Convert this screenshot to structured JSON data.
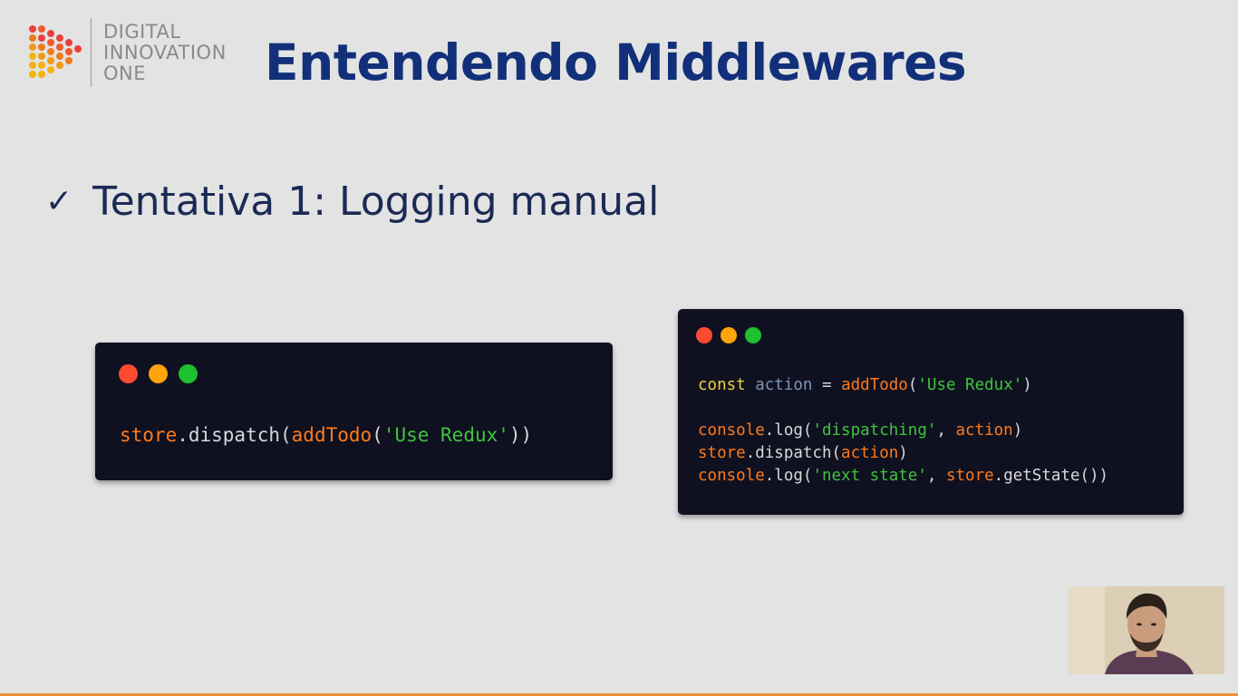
{
  "brand": {
    "line1": "DIGITAL",
    "line2": "INNOVATION",
    "line3": "ONE",
    "logo_colors": [
      "#f5b30f",
      "#ef7b1e",
      "#e8413c"
    ]
  },
  "slide": {
    "title": "Entendendo Middlewares",
    "bullet_icon": "check-icon",
    "bullet_check": "✓",
    "bullet_text": "Tentativa 1: Logging manual"
  },
  "code1": {
    "tokens": [
      "store",
      ".dispatch(",
      "addTodo",
      "(",
      "'Use Redux'",
      "))"
    ]
  },
  "code2": {
    "line1": [
      "const",
      " ",
      "action",
      " = ",
      "addTodo",
      "(",
      "'Use Redux'",
      ")"
    ],
    "line2": [
      "console",
      ".log(",
      "'dispatching'",
      ", ",
      "action",
      ")"
    ],
    "line3": [
      "store",
      ".dispatch(",
      "action",
      ")"
    ],
    "line4": [
      "console",
      ".log(",
      "'next state'",
      ", ",
      "store",
      ".getState())"
    ]
  },
  "webcam": {
    "label": "presenter-webcam"
  },
  "colors": {
    "background": "#e3e3e3",
    "title": "#12307a",
    "code_bg": "#0f1121",
    "keyword": "#f0d23a",
    "function": "#ff7a1a",
    "string": "#3fc43a",
    "accent_bar": "#e8913a"
  }
}
